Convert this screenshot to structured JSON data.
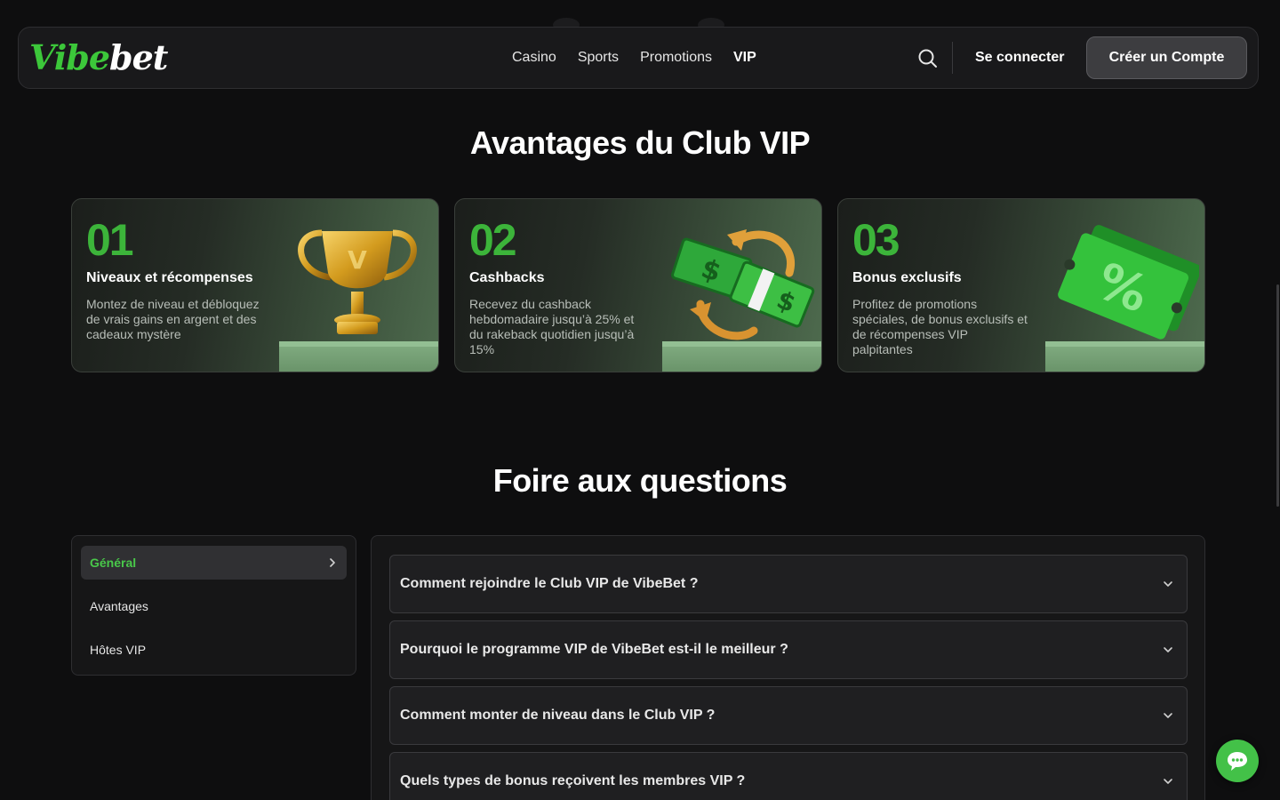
{
  "colors": {
    "brand_green": "#3cc73a",
    "background": "#0e0e0f",
    "card_border": "#3a3f3a"
  },
  "header": {
    "logo": {
      "part1": "Vibe",
      "part2": "bet"
    },
    "nav": [
      {
        "label": "Casino",
        "active": false
      },
      {
        "label": "Sports",
        "active": false
      },
      {
        "label": "Promotions",
        "active": false
      },
      {
        "label": "VIP",
        "active": true
      }
    ],
    "search_icon": "search-icon",
    "login_label": "Se connecter",
    "signup_label": "Créer un Compte"
  },
  "benefits": {
    "title": "Avantages du Club VIP",
    "cards": [
      {
        "num": "01",
        "title": "Niveaux et récompenses",
        "desc": "Montez de niveau et débloquez de vrais gains en argent et des cadeaux mystère",
        "art": "trophy-icon"
      },
      {
        "num": "02",
        "title": "Cashbacks",
        "desc": "Recevez du cashback hebdomadaire jusqu’à 25% et du rakeback quotidien jusqu’à 15%",
        "art": "cash-stack-icon"
      },
      {
        "num": "03",
        "title": "Bonus exclusifs",
        "desc": "Profitez de promotions spéciales, de bonus exclusifs et de récompenses VIP palpitantes",
        "art": "percent-ticket-icon"
      }
    ]
  },
  "faq": {
    "title": "Foire aux questions",
    "categories": [
      {
        "label": "Général",
        "active": true
      },
      {
        "label": "Avantages",
        "active": false
      },
      {
        "label": "Hôtes VIP",
        "active": false
      }
    ],
    "questions": [
      {
        "q": "Comment rejoindre le Club VIP de VibeBet ?"
      },
      {
        "q": "Pourquoi le programme VIP de VibeBet est-il le meilleur ?"
      },
      {
        "q": "Comment monter de niveau dans le Club VIP ?"
      },
      {
        "q": "Quels types de bonus reçoivent les membres VIP ?"
      }
    ]
  },
  "chat_icon": "chat-icon"
}
